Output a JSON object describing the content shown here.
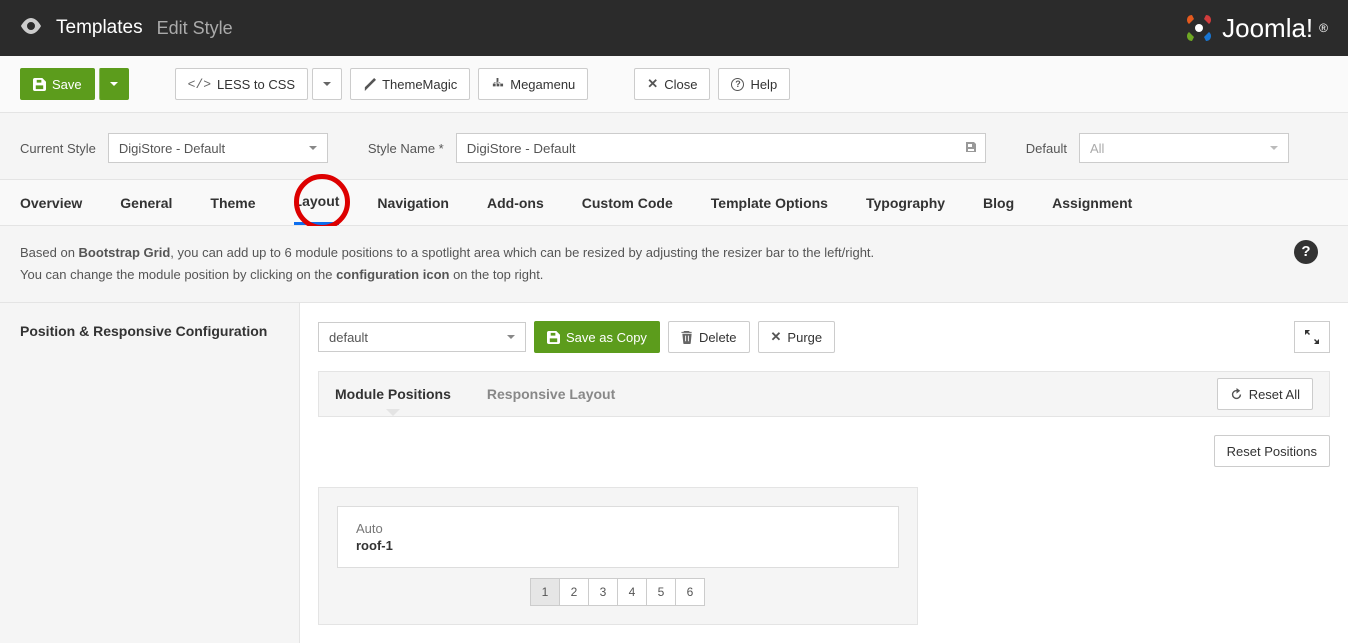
{
  "header": {
    "title": "Templates",
    "subtitle": "Edit Style",
    "logo": "Joomla!"
  },
  "toolbar": {
    "save": "Save",
    "less": "LESS to CSS",
    "thememagic": "ThemeMagic",
    "megamenu": "Megamenu",
    "close": "Close",
    "help": "Help"
  },
  "formbar": {
    "current_style_label": "Current Style",
    "current_style_value": "DigiStore - Default",
    "style_name_label": "Style Name *",
    "style_name_value": "DigiStore - Default",
    "default_label": "Default",
    "default_value": "All"
  },
  "tabs": [
    "Overview",
    "General",
    "Theme",
    "Layout",
    "Navigation",
    "Add-ons",
    "Custom Code",
    "Template Options",
    "Typography",
    "Blog",
    "Assignment"
  ],
  "active_tab": "Layout",
  "description": {
    "part1": "Based on ",
    "bold1": "Bootstrap Grid",
    "part2": ", you can add up to 6 module positions to a spotlight area which can be resized by adjusting the resizer bar to the left/right.",
    "line2a": "You can change the module position by clicking on the ",
    "bold2": "configuration icon",
    "line2b": " on the top right."
  },
  "side": {
    "title": "Position & Responsive Configuration"
  },
  "content": {
    "select_value": "default",
    "save_as_copy": "Save as Copy",
    "delete": "Delete",
    "purge": "Purge",
    "reset_all": "Reset All",
    "reset_positions": "Reset Positions"
  },
  "subtabs": {
    "positions": "Module Positions",
    "responsive": "Responsive Layout"
  },
  "module": {
    "auto": "Auto",
    "name": "roof-1"
  },
  "pages": [
    "1",
    "2",
    "3",
    "4",
    "5",
    "6"
  ],
  "active_page": "1"
}
